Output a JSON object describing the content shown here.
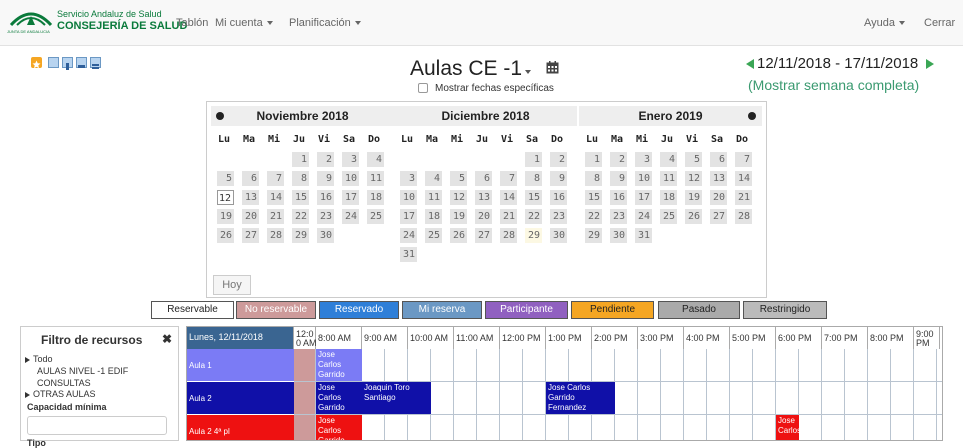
{
  "brand": {
    "line1": "Servicio Andaluz de Salud",
    "line2": "CONSEJERÍA DE SALUD",
    "line3": "JUNTA DE ANDALUCIA"
  },
  "nav": {
    "tablon": "Tablón",
    "mi_cuenta": "Mi cuenta",
    "planificacion": "Planificación",
    "ayuda": "Ayuda",
    "cerrar": "Cerrar"
  },
  "header": {
    "title": "Aulas CE -1",
    "show_dates_label": "Mostrar fechas específicas",
    "week_range": "12/11/2018 - 17/11/2018",
    "show_full_week": "(Mostrar semana completa)"
  },
  "datepicker": {
    "dow": [
      "Lu",
      "Ma",
      "Mi",
      "Ju",
      "Vi",
      "Sa",
      "Do"
    ],
    "months": [
      {
        "name": "Noviembre 2018",
        "lead": 3,
        "days": 30,
        "after": 0
      },
      {
        "name": "Diciembre 2018",
        "lead": 5,
        "days": 31,
        "after": 0
      },
      {
        "name": "Enero 2019",
        "lead": 0,
        "days": 31,
        "after": 0
      }
    ],
    "today_label": "Hoy"
  },
  "legend": [
    {
      "label": "Reservable",
      "bg": "#ffffff",
      "fg": "#222222"
    },
    {
      "label": "No reservable",
      "bg": "#cd9a9a",
      "fg": "#ffffff"
    },
    {
      "label": "Reservado",
      "bg": "#2f7fd8",
      "fg": "#ffffff"
    },
    {
      "label": "Mi reserva",
      "bg": "#6b98c4",
      "fg": "#ffffff"
    },
    {
      "label": "Participante",
      "bg": "#9060c0",
      "fg": "#ffffff"
    },
    {
      "label": "Pendiente",
      "bg": "#f5a623",
      "fg": "#222222"
    },
    {
      "label": "Pasado",
      "bg": "#aaaaaa",
      "fg": "#222222"
    },
    {
      "label": "Restringido",
      "bg": "#bbbbbb",
      "fg": "#222222"
    }
  ],
  "filter": {
    "title": "Filtro de recursos",
    "todo": "Todo",
    "aulas_nivel": "AULAS NIVEL -1 EDIF",
    "consultas": "CONSULTAS",
    "otras_aulas": "OTRAS AULAS",
    "capacidad": "Capacidad mínima",
    "tipo": "Tipo"
  },
  "schedule": {
    "date_header": "Lunes, 12/11/2018",
    "hours": [
      "12:0\n0 AM",
      "8:00 AM",
      "9:00 AM",
      "10:00 AM",
      "11:00 AM",
      "12:00 PM",
      "1:00 PM",
      "2:00 PM",
      "3:00 PM",
      "4:00 PM",
      "5:00 PM",
      "6:00 PM",
      "7:00 PM",
      "8:00 PM",
      "9:00\nPM"
    ],
    "rows": [
      {
        "name": "Aula 1",
        "color": "#7b7bf5"
      },
      {
        "name": "Aula 2",
        "color": "#1010a8"
      },
      {
        "name": "Aula 2 4ª pl",
        "color": "#ee1111"
      }
    ],
    "events": [
      {
        "row": 0,
        "start": 1,
        "span": 2,
        "text": "Jose Carlos Garrido Fernandez",
        "color": "#7b7bf5"
      },
      {
        "row": 1,
        "start": 1,
        "span": 2,
        "text": "Jose Carlos Garrido Fernandez",
        "color": "#1010a8"
      },
      {
        "row": 1,
        "start": 3,
        "span": 3,
        "text": "Joaquin Toro Santiago",
        "color": "#1010a8"
      },
      {
        "row": 1,
        "start": 11,
        "span": 3,
        "text": "Jose Carlos Garrido Fernandez",
        "color": "#1010a8"
      },
      {
        "row": 2,
        "start": 1,
        "span": 2,
        "text": "Jose Carlos Garrido",
        "color": "#ee1111"
      },
      {
        "row": 2,
        "start": 21,
        "span": 1,
        "text": "Jose Carlos",
        "color": "#ee1111"
      }
    ]
  }
}
